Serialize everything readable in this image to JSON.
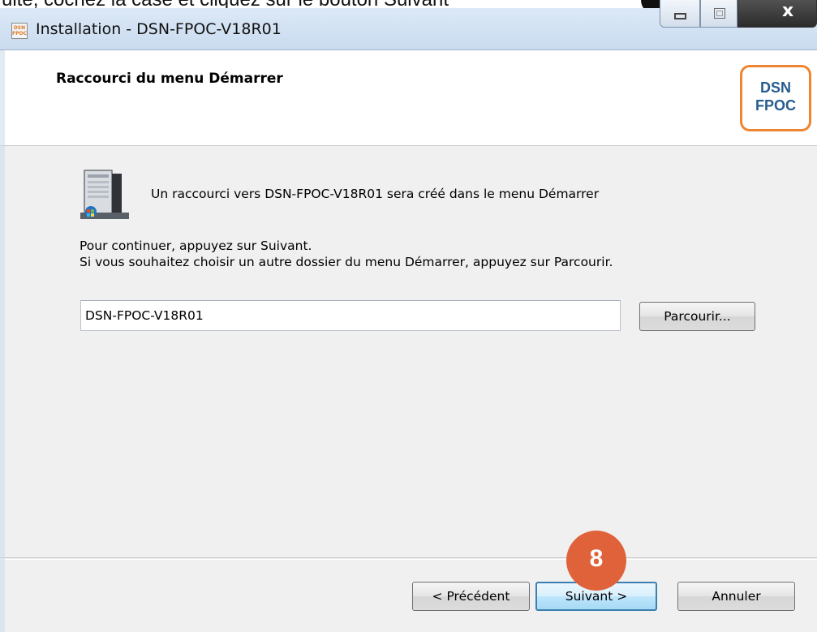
{
  "top_caption": "uite, cochez la case et cliquez sur le bouton Suivant",
  "window": {
    "title": "Installation - DSN-FPOC-V18R01",
    "app_icon_text": "DSN FPOC",
    "close_glyph": "x"
  },
  "header": {
    "title": "Raccourci du menu Démarrer",
    "logo_line1": "DSN",
    "logo_line2": "FPOC"
  },
  "content": {
    "shortcut_message": "Un raccourci vers DSN-FPOC-V18R01 sera créé dans le menu Démarrer",
    "continue_line1": "Pour continuer, appuyez sur Suivant.",
    "continue_line2": "Si vous souhaitez choisir un autre dossier du menu Démarrer, appuyez sur Parcourir.",
    "folder_value": "DSN-FPOC-V18R01",
    "browse_label": "Parcourir..."
  },
  "footer": {
    "back_label": "< Précédent",
    "next_label": "Suivant >",
    "cancel_label": "Annuler"
  },
  "annotation": {
    "step_number": "8",
    "color": "#e0623b"
  }
}
